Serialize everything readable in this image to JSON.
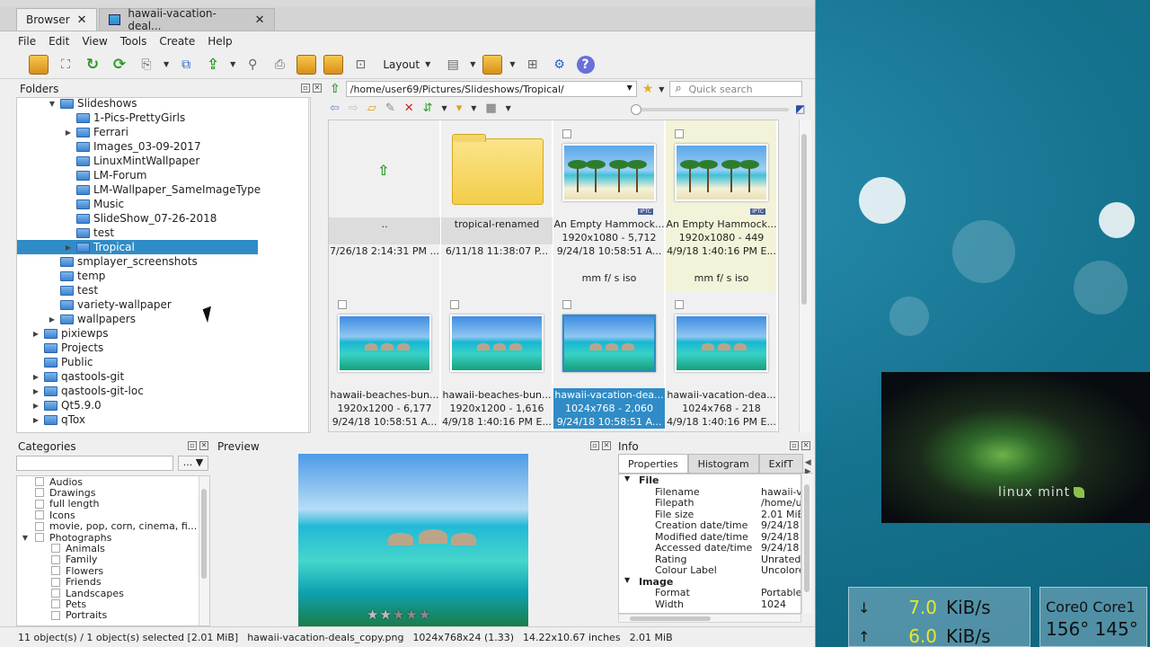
{
  "tabs": [
    {
      "label": "Browser"
    },
    {
      "label": "hawaii-vacation-deal..."
    }
  ],
  "menu": [
    "File",
    "Edit",
    "View",
    "Tools",
    "Create",
    "Help"
  ],
  "toolbar": {
    "layout_label": "Layout"
  },
  "folders": {
    "title": "Folders",
    "items": [
      {
        "label": "Slideshows",
        "depth": 1,
        "arrow": "▼"
      },
      {
        "label": "1-Pics-PrettyGirls",
        "depth": 2,
        "arrow": ""
      },
      {
        "label": "Ferrari",
        "depth": 2,
        "arrow": "▶"
      },
      {
        "label": "Images_03-09-2017",
        "depth": 2,
        "arrow": ""
      },
      {
        "label": "LinuxMintWallpaper",
        "depth": 2,
        "arrow": ""
      },
      {
        "label": "LM-Forum",
        "depth": 2,
        "arrow": ""
      },
      {
        "label": "LM-Wallpaper_SameImageType",
        "depth": 2,
        "arrow": ""
      },
      {
        "label": "Music",
        "depth": 2,
        "arrow": ""
      },
      {
        "label": "SlideShow_07-26-2018",
        "depth": 2,
        "arrow": ""
      },
      {
        "label": "test",
        "depth": 2,
        "arrow": ""
      },
      {
        "label": "Tropical",
        "depth": 2,
        "arrow": "▶",
        "selected": true
      },
      {
        "label": "smplayer_screenshots",
        "depth": 1,
        "arrow": ""
      },
      {
        "label": "temp",
        "depth": 1,
        "arrow": ""
      },
      {
        "label": "test",
        "depth": 1,
        "arrow": ""
      },
      {
        "label": "variety-wallpaper",
        "depth": 1,
        "arrow": ""
      },
      {
        "label": "wallpapers",
        "depth": 1,
        "arrow": "▶"
      },
      {
        "label": "pixiewps",
        "depth": 0,
        "arrow": "▶"
      },
      {
        "label": "Projects",
        "depth": 0,
        "arrow": ""
      },
      {
        "label": "Public",
        "depth": 0,
        "arrow": ""
      },
      {
        "label": "qastools-git",
        "depth": 0,
        "arrow": "▶"
      },
      {
        "label": "qastools-git-loc",
        "depth": 0,
        "arrow": "▶"
      },
      {
        "label": "Qt5.9.0",
        "depth": 0,
        "arrow": "▶"
      },
      {
        "label": "qTox",
        "depth": 0,
        "arrow": "▶"
      }
    ]
  },
  "browser": {
    "path": "/home/user69/Pictures/Slideshows/Tropical/",
    "search_placeholder": "Quick search",
    "cells": [
      {
        "kind": "up",
        "name": "..",
        "dims": "",
        "date": "7/26/18 2:14:31 PM ...",
        "exif": ""
      },
      {
        "kind": "folder",
        "name": "tropical-renamed",
        "dims": "",
        "date": "6/11/18 11:38:07 P...",
        "exif": ""
      },
      {
        "kind": "beach",
        "name": "An Empty Hammock...",
        "dims": "1920x1080 - 5,712",
        "date": "9/24/18 10:58:51 A...",
        "exif": "mm f/ s iso",
        "iptc": "IPTC"
      },
      {
        "kind": "beach",
        "name": "An Empty Hammock...",
        "dims": "1920x1080 - 449",
        "date": "4/9/18 1:40:16 PM E...",
        "exif": "mm f/ s iso",
        "iptc": "IPTC",
        "tint": true
      },
      {
        "kind": "bora",
        "name": "hawaii-beaches-bun...",
        "dims": "1920x1200 - 6,177",
        "date": "9/24/18 10:58:51 A..."
      },
      {
        "kind": "bora",
        "name": "hawaii-beaches-bun...",
        "dims": "1920x1200 - 1,616",
        "date": "4/9/18 1:40:16 PM E..."
      },
      {
        "kind": "bora",
        "name": "hawaii-vacation-dea...",
        "dims": "1024x768 - 2,060",
        "date": "9/24/18 10:58:51 A...",
        "selected": true
      },
      {
        "kind": "bora",
        "name": "hawaii-vacation-dea...",
        "dims": "1024x768 - 218",
        "date": "4/9/18 1:40:16 PM E..."
      }
    ]
  },
  "categories": {
    "title": "Categories",
    "btn": "...",
    "items": [
      {
        "label": "Audios",
        "depth": 0
      },
      {
        "label": "Drawings",
        "depth": 0
      },
      {
        "label": "full length",
        "depth": 0
      },
      {
        "label": "Icons",
        "depth": 0
      },
      {
        "label": "movie, pop, corn, cinema, fi...",
        "depth": 0
      },
      {
        "label": "Photographs",
        "depth": 0,
        "arrow": "▼"
      },
      {
        "label": "Animals",
        "depth": 1
      },
      {
        "label": "Family",
        "depth": 1
      },
      {
        "label": "Flowers",
        "depth": 1
      },
      {
        "label": "Friends",
        "depth": 1
      },
      {
        "label": "Landscapes",
        "depth": 1
      },
      {
        "label": "Pets",
        "depth": 1
      },
      {
        "label": "Portraits",
        "depth": 1
      }
    ]
  },
  "preview": {
    "title": "Preview",
    "rating": 2
  },
  "info": {
    "title": "Info",
    "tabs": [
      "Properties",
      "Histogram",
      "ExifT"
    ],
    "rows": [
      {
        "k": "File",
        "v": "",
        "group": true
      },
      {
        "k": "Filename",
        "v": "hawaii-v"
      },
      {
        "k": "Filepath",
        "v": "/home/u"
      },
      {
        "k": "File size",
        "v": "2.01 MiB"
      },
      {
        "k": "Creation date/time",
        "v": "9/24/18"
      },
      {
        "k": "Modified date/time",
        "v": "9/24/18"
      },
      {
        "k": "Accessed date/time",
        "v": "9/24/18"
      },
      {
        "k": "Rating",
        "v": "Unrated"
      },
      {
        "k": "Colour Label",
        "v": "Uncolore"
      },
      {
        "k": "Image",
        "v": "",
        "group": true
      },
      {
        "k": "Format",
        "v": "Portable"
      },
      {
        "k": "Width",
        "v": "1024"
      }
    ]
  },
  "status": {
    "selection": "11 object(s) / 1 object(s) selected [2.01 MiB]",
    "file": "hawaii-vacation-deals_copy.png",
    "dims": "1024x768x24 (1.33)",
    "inches": "14.22x10.67 inches",
    "size": "2.01 MiB"
  },
  "desktop": {
    "mint_text": "linux mint",
    "net": [
      {
        "arrow": "↓",
        "value": "7.0",
        "unit": "KiB/s"
      },
      {
        "arrow": "↑",
        "value": "6.0",
        "unit": "KiB/s"
      }
    ],
    "cpu": {
      "header": "Core0 Core1",
      "temps": "156° 145°"
    }
  }
}
